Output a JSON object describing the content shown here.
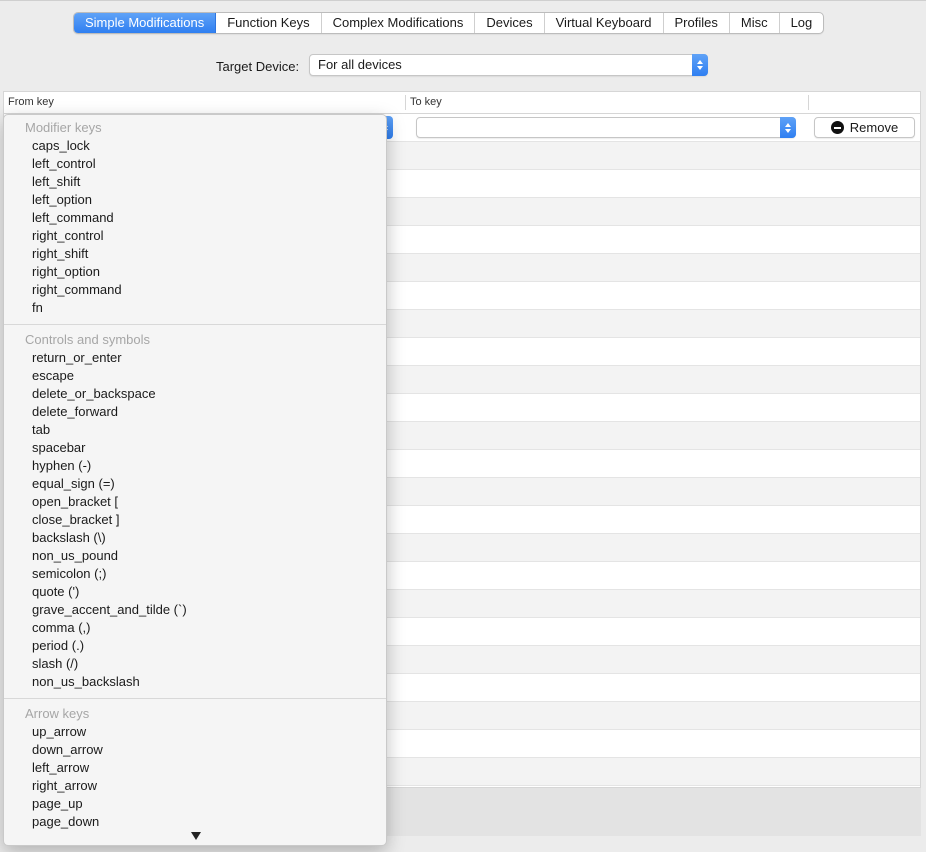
{
  "tabs": [
    {
      "label": "Simple Modifications",
      "active": true
    },
    {
      "label": "Function Keys",
      "active": false
    },
    {
      "label": "Complex Modifications",
      "active": false
    },
    {
      "label": "Devices",
      "active": false
    },
    {
      "label": "Virtual Keyboard",
      "active": false
    },
    {
      "label": "Profiles",
      "active": false
    },
    {
      "label": "Misc",
      "active": false
    },
    {
      "label": "Log",
      "active": false
    }
  ],
  "target_device": {
    "label": "Target Device:",
    "value": "For all devices"
  },
  "table": {
    "columns": {
      "from": "From key",
      "to": "To key"
    },
    "to_key_value": "",
    "remove_label": "Remove"
  },
  "menu": {
    "groups": [
      {
        "title": "Modifier keys",
        "items": [
          "caps_lock",
          "left_control",
          "left_shift",
          "left_option",
          "left_command",
          "right_control",
          "right_shift",
          "right_option",
          "right_command",
          "fn"
        ]
      },
      {
        "title": "Controls and symbols",
        "items": [
          "return_or_enter",
          "escape",
          "delete_or_backspace",
          "delete_forward",
          "tab",
          "spacebar",
          "hyphen (-)",
          "equal_sign (=)",
          "open_bracket [",
          "close_bracket ]",
          "backslash (\\)",
          "non_us_pound",
          "semicolon (;)",
          "quote (')",
          "grave_accent_and_tilde (`)",
          "comma (,)",
          "period (.)",
          "slash (/)",
          "non_us_backslash"
        ]
      },
      {
        "title": "Arrow keys",
        "items": [
          "up_arrow",
          "down_arrow",
          "left_arrow",
          "right_arrow",
          "page_up",
          "page_down"
        ]
      }
    ]
  },
  "colors": {
    "accent": "#2f7ff1"
  }
}
